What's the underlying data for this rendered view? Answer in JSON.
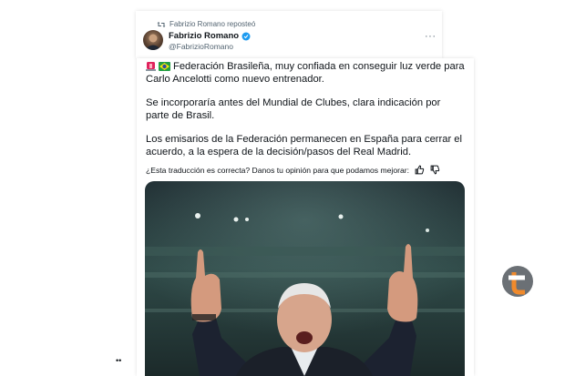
{
  "repost": {
    "text": "Fabrizio Romano reposteó",
    "icon": "repost-icon"
  },
  "author": {
    "name": "Fabrizio Romano",
    "handle": "@FabrizioRomano",
    "verified_color": "#1d9bf0"
  },
  "menu": {
    "label": "···"
  },
  "tweet": {
    "flags": [
      "siren-emoji",
      "brazil-flag-emoji"
    ],
    "paragraphs": [
      "Federación Brasileña, muy confiada en conseguir luz verde para Carlo Ancelotti como nuevo entrenador.",
      "Se incorporaría antes del Mundial de Clubes, clara indicación por parte de Brasil.",
      "Los emisarios de la Federación permanecen en España para cerrar el acuerdo, a la espera de la decisión/pasos del Real Madrid."
    ]
  },
  "feedback": {
    "text": "¿Esta traducción es correcta? Danos tu opinión para que podamos mejorar:"
  },
  "pager": {
    "text": "••"
  },
  "colors": {
    "text": "#0f1419",
    "secondary": "#536471",
    "accent": "#1d9bf0"
  }
}
